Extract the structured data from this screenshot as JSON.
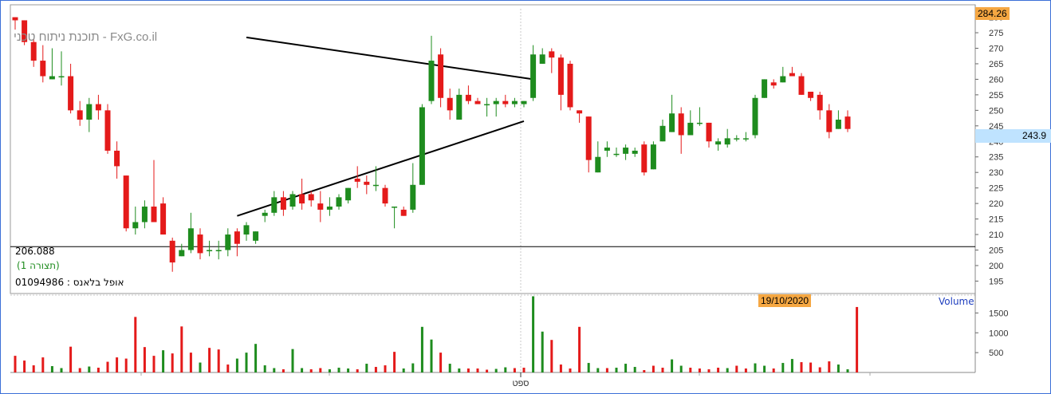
{
  "header": {
    "watermark": "תוכנת ניתוח טכני - FxG.co.il",
    "security_name": "אופל בלאנס",
    "security_id": "01094986",
    "period_label": "(תצורה 1)"
  },
  "price_panel": {
    "last_price_badge": "284.26",
    "current_price": "243.9",
    "horizontal_line_label": "206.088",
    "y_ticks": [
      "195",
      "200",
      "205",
      "210",
      "215",
      "220",
      "225",
      "230",
      "235",
      "240",
      "245",
      "250",
      "255",
      "260",
      "265",
      "270",
      "275",
      "280"
    ]
  },
  "volume_panel": {
    "label": "Volume",
    "date_badge": "19/10/2020",
    "y_ticks": [
      "500",
      "1000",
      "1500"
    ]
  },
  "x_axis": {
    "month_label": "ספט"
  },
  "colors": {
    "up": "#1e8c1e",
    "down": "#e41a1a",
    "line": "#000000",
    "badge_orange": "#f5a742",
    "badge_blue": "#bfe3ff",
    "frame": "#3b6fd8"
  },
  "chart_data": {
    "type": "candlestick",
    "ylim": [
      191,
      284
    ],
    "volume_ylim": [
      0,
      1950
    ],
    "horizontal_line": 206.088,
    "trendlines": [
      {
        "from": [
          25,
          273.5
        ],
        "to": [
          56,
          260.0
        ]
      },
      {
        "from": [
          24,
          216.0
        ],
        "to": [
          55,
          246.5
        ]
      }
    ],
    "candles": [
      {
        "o": 280,
        "h": 280,
        "l": 276,
        "c": 279
      },
      {
        "o": 279,
        "h": 279,
        "l": 271,
        "c": 272
      },
      {
        "o": 272,
        "h": 273,
        "l": 264,
        "c": 266
      },
      {
        "o": 266,
        "h": 271,
        "l": 259,
        "c": 261
      },
      {
        "o": 260,
        "h": 270,
        "l": 260,
        "c": 261
      },
      {
        "o": 261,
        "h": 269,
        "l": 258,
        "c": 261
      },
      {
        "o": 261,
        "h": 265,
        "l": 249,
        "c": 250
      },
      {
        "o": 250,
        "h": 253,
        "l": 245,
        "c": 247
      },
      {
        "o": 247,
        "h": 254,
        "l": 243,
        "c": 252
      },
      {
        "o": 252,
        "h": 255,
        "l": 247,
        "c": 250
      },
      {
        "o": 250,
        "h": 252,
        "l": 236,
        "c": 237
      },
      {
        "o": 237,
        "h": 240,
        "l": 228,
        "c": 232
      },
      {
        "o": 229,
        "h": 229,
        "l": 211,
        "c": 212
      },
      {
        "o": 212,
        "h": 219,
        "l": 210,
        "c": 214
      },
      {
        "o": 214,
        "h": 221,
        "l": 212,
        "c": 219
      },
      {
        "o": 219,
        "h": 234,
        "l": 214,
        "c": 214
      },
      {
        "o": 220,
        "h": 222,
        "l": 210,
        "c": 210
      },
      {
        "o": 208,
        "h": 209,
        "l": 198,
        "c": 201
      },
      {
        "o": 203,
        "h": 207,
        "l": 203,
        "c": 205
      },
      {
        "o": 205,
        "h": 217,
        "l": 204,
        "c": 212
      },
      {
        "o": 210,
        "h": 212,
        "l": 202,
        "c": 204
      },
      {
        "o": 205,
        "h": 208,
        "l": 203,
        "c": 205
      },
      {
        "o": 205,
        "h": 208,
        "l": 202,
        "c": 205
      },
      {
        "o": 205,
        "h": 212,
        "l": 203,
        "c": 210
      },
      {
        "o": 211,
        "h": 212,
        "l": 203,
        "c": 207
      },
      {
        "o": 210,
        "h": 214,
        "l": 208,
        "c": 213
      },
      {
        "o": 208,
        "h": 211,
        "l": 207,
        "c": 211
      },
      {
        "o": 216,
        "h": 218,
        "l": 214,
        "c": 217
      },
      {
        "o": 217,
        "h": 224,
        "l": 216,
        "c": 222
      },
      {
        "o": 222,
        "h": 224,
        "l": 216,
        "c": 218
      },
      {
        "o": 219,
        "h": 224,
        "l": 218,
        "c": 223
      },
      {
        "o": 223,
        "h": 228,
        "l": 218,
        "c": 220
      },
      {
        "o": 223,
        "h": 224,
        "l": 219,
        "c": 221
      },
      {
        "o": 220,
        "h": 224,
        "l": 214,
        "c": 218
      },
      {
        "o": 218,
        "h": 222,
        "l": 216,
        "c": 219
      },
      {
        "o": 219,
        "h": 223,
        "l": 218,
        "c": 222
      },
      {
        "o": 221,
        "h": 225,
        "l": 220,
        "c": 225
      },
      {
        "o": 228,
        "h": 232,
        "l": 225,
        "c": 227
      },
      {
        "o": 227,
        "h": 229,
        "l": 223,
        "c": 226
      },
      {
        "o": 226,
        "h": 232,
        "l": 224,
        "c": 226
      },
      {
        "o": 225,
        "h": 226,
        "l": 219,
        "c": 220
      },
      {
        "o": 219,
        "h": 219,
        "l": 212,
        "c": 219
      },
      {
        "o": 218,
        "h": 219,
        "l": 216,
        "c": 216
      },
      {
        "o": 218,
        "h": 233,
        "l": 217,
        "c": 226
      },
      {
        "o": 226,
        "h": 252,
        "l": 226,
        "c": 251
      },
      {
        "o": 253,
        "h": 274,
        "l": 252,
        "c": 266
      },
      {
        "o": 268,
        "h": 270,
        "l": 251,
        "c": 254
      },
      {
        "o": 254,
        "h": 257,
        "l": 247,
        "c": 250
      },
      {
        "o": 247,
        "h": 257,
        "l": 247,
        "c": 255
      },
      {
        "o": 255,
        "h": 258,
        "l": 252,
        "c": 253
      },
      {
        "o": 253,
        "h": 254,
        "l": 252,
        "c": 252
      },
      {
        "o": 252,
        "h": 254,
        "l": 248,
        "c": 252
      },
      {
        "o": 252,
        "h": 254,
        "l": 248,
        "c": 253
      },
      {
        "o": 253,
        "h": 255,
        "l": 251,
        "c": 252
      },
      {
        "o": 252,
        "h": 254,
        "l": 251,
        "c": 253
      },
      {
        "o": 252,
        "h": 253,
        "l": 251,
        "c": 253
      },
      {
        "o": 254,
        "h": 271,
        "l": 253,
        "c": 268
      },
      {
        "o": 265,
        "h": 270,
        "l": 265,
        "c": 268
      },
      {
        "o": 269,
        "h": 270,
        "l": 262,
        "c": 267
      },
      {
        "o": 267,
        "h": 268,
        "l": 250,
        "c": 255
      },
      {
        "o": 265,
        "h": 266,
        "l": 250,
        "c": 251
      },
      {
        "o": 250,
        "h": 250,
        "l": 246,
        "c": 249
      },
      {
        "o": 248,
        "h": 248,
        "l": 230,
        "c": 234
      },
      {
        "o": 230,
        "h": 240,
        "l": 230,
        "c": 235
      },
      {
        "o": 237,
        "h": 240,
        "l": 235,
        "c": 238
      },
      {
        "o": 236,
        "h": 238,
        "l": 235,
        "c": 236
      },
      {
        "o": 236,
        "h": 239,
        "l": 234,
        "c": 238
      },
      {
        "o": 236,
        "h": 238,
        "l": 235,
        "c": 237
      },
      {
        "o": 239,
        "h": 240,
        "l": 229,
        "c": 230
      },
      {
        "o": 231,
        "h": 240,
        "l": 231,
        "c": 239
      },
      {
        "o": 240,
        "h": 247,
        "l": 240,
        "c": 245
      },
      {
        "o": 243,
        "h": 255,
        "l": 243,
        "c": 249
      },
      {
        "o": 249,
        "h": 251,
        "l": 236,
        "c": 242
      },
      {
        "o": 242,
        "h": 250,
        "l": 242,
        "c": 246
      },
      {
        "o": 246,
        "h": 251,
        "l": 245,
        "c": 246
      },
      {
        "o": 246,
        "h": 246,
        "l": 238,
        "c": 240
      },
      {
        "o": 239,
        "h": 241,
        "l": 237,
        "c": 240
      },
      {
        "o": 239,
        "h": 244,
        "l": 238,
        "c": 241
      },
      {
        "o": 241,
        "h": 242,
        "l": 240,
        "c": 241
      },
      {
        "o": 241,
        "h": 243,
        "l": 240,
        "c": 241
      },
      {
        "o": 242,
        "h": 255,
        "l": 241,
        "c": 254
      },
      {
        "o": 254,
        "h": 260,
        "l": 254,
        "c": 260
      },
      {
        "o": 259,
        "h": 260,
        "l": 257,
        "c": 258
      },
      {
        "o": 259,
        "h": 264,
        "l": 259,
        "c": 261
      },
      {
        "o": 262,
        "h": 264,
        "l": 261,
        "c": 261
      },
      {
        "o": 261,
        "h": 262,
        "l": 255,
        "c": 255
      },
      {
        "o": 256,
        "h": 256,
        "l": 253,
        "c": 254
      },
      {
        "o": 255,
        "h": 256,
        "l": 247,
        "c": 250
      },
      {
        "o": 250,
        "h": 252,
        "l": 241,
        "c": 243
      },
      {
        "o": 244,
        "h": 250,
        "l": 244,
        "c": 247
      },
      {
        "o": 248,
        "h": 250,
        "l": 243,
        "c": 244
      }
    ],
    "volumes": [
      {
        "v": 420,
        "up": false
      },
      {
        "v": 300,
        "up": false
      },
      {
        "v": 180,
        "up": false
      },
      {
        "v": 380,
        "up": false
      },
      {
        "v": 160,
        "up": true
      },
      {
        "v": 110,
        "up": true
      },
      {
        "v": 650,
        "up": false
      },
      {
        "v": 110,
        "up": false
      },
      {
        "v": 150,
        "up": true
      },
      {
        "v": 120,
        "up": false
      },
      {
        "v": 270,
        "up": false
      },
      {
        "v": 380,
        "up": false
      },
      {
        "v": 350,
        "up": false
      },
      {
        "v": 1400,
        "up": false
      },
      {
        "v": 640,
        "up": false
      },
      {
        "v": 420,
        "up": false
      },
      {
        "v": 560,
        "up": true
      },
      {
        "v": 480,
        "up": false
      },
      {
        "v": 1160,
        "up": false
      },
      {
        "v": 500,
        "up": false
      },
      {
        "v": 250,
        "up": true
      },
      {
        "v": 620,
        "up": false
      },
      {
        "v": 580,
        "up": false
      },
      {
        "v": 200,
        "up": false
      },
      {
        "v": 350,
        "up": true
      },
      {
        "v": 500,
        "up": true
      },
      {
        "v": 720,
        "up": true
      },
      {
        "v": 180,
        "up": true
      },
      {
        "v": 110,
        "up": true
      },
      {
        "v": 80,
        "up": false
      },
      {
        "v": 590,
        "up": true
      },
      {
        "v": 110,
        "up": true
      },
      {
        "v": 80,
        "up": false
      },
      {
        "v": 110,
        "up": false
      },
      {
        "v": 80,
        "up": true
      },
      {
        "v": 120,
        "up": true
      },
      {
        "v": 100,
        "up": true
      },
      {
        "v": 80,
        "up": false
      },
      {
        "v": 220,
        "up": true
      },
      {
        "v": 140,
        "up": false
      },
      {
        "v": 180,
        "up": false
      },
      {
        "v": 520,
        "up": false
      },
      {
        "v": 100,
        "up": true
      },
      {
        "v": 230,
        "up": true
      },
      {
        "v": 1150,
        "up": true
      },
      {
        "v": 830,
        "up": true
      },
      {
        "v": 500,
        "up": false
      },
      {
        "v": 220,
        "up": true
      },
      {
        "v": 100,
        "up": true
      },
      {
        "v": 100,
        "up": false
      },
      {
        "v": 100,
        "up": false
      },
      {
        "v": 70,
        "up": false
      },
      {
        "v": 90,
        "up": true
      },
      {
        "v": 130,
        "up": true
      },
      {
        "v": 110,
        "up": false
      },
      {
        "v": 120,
        "up": false
      },
      {
        "v": 1920,
        "up": true
      },
      {
        "v": 1030,
        "up": true
      },
      {
        "v": 820,
        "up": false
      },
      {
        "v": 200,
        "up": false
      },
      {
        "v": 100,
        "up": false
      },
      {
        "v": 1150,
        "up": false
      },
      {
        "v": 240,
        "up": true
      },
      {
        "v": 110,
        "up": true
      },
      {
        "v": 110,
        "up": false
      },
      {
        "v": 120,
        "up": true
      },
      {
        "v": 220,
        "up": true
      },
      {
        "v": 140,
        "up": true
      },
      {
        "v": 60,
        "up": false
      },
      {
        "v": 170,
        "up": false
      },
      {
        "v": 120,
        "up": false
      },
      {
        "v": 330,
        "up": true
      },
      {
        "v": 170,
        "up": true
      },
      {
        "v": 120,
        "up": false
      },
      {
        "v": 100,
        "up": false
      },
      {
        "v": 80,
        "up": false
      },
      {
        "v": 120,
        "up": false
      },
      {
        "v": 110,
        "up": true
      },
      {
        "v": 170,
        "up": false
      },
      {
        "v": 100,
        "up": false
      },
      {
        "v": 230,
        "up": true
      },
      {
        "v": 170,
        "up": true
      },
      {
        "v": 100,
        "up": false
      },
      {
        "v": 240,
        "up": true
      },
      {
        "v": 340,
        "up": true
      },
      {
        "v": 260,
        "up": false
      },
      {
        "v": 250,
        "up": false
      },
      {
        "v": 130,
        "up": false
      },
      {
        "v": 280,
        "up": false
      },
      {
        "v": 200,
        "up": true
      },
      {
        "v": 80,
        "up": true
      },
      {
        "v": 1650,
        "up": false
      }
    ]
  }
}
